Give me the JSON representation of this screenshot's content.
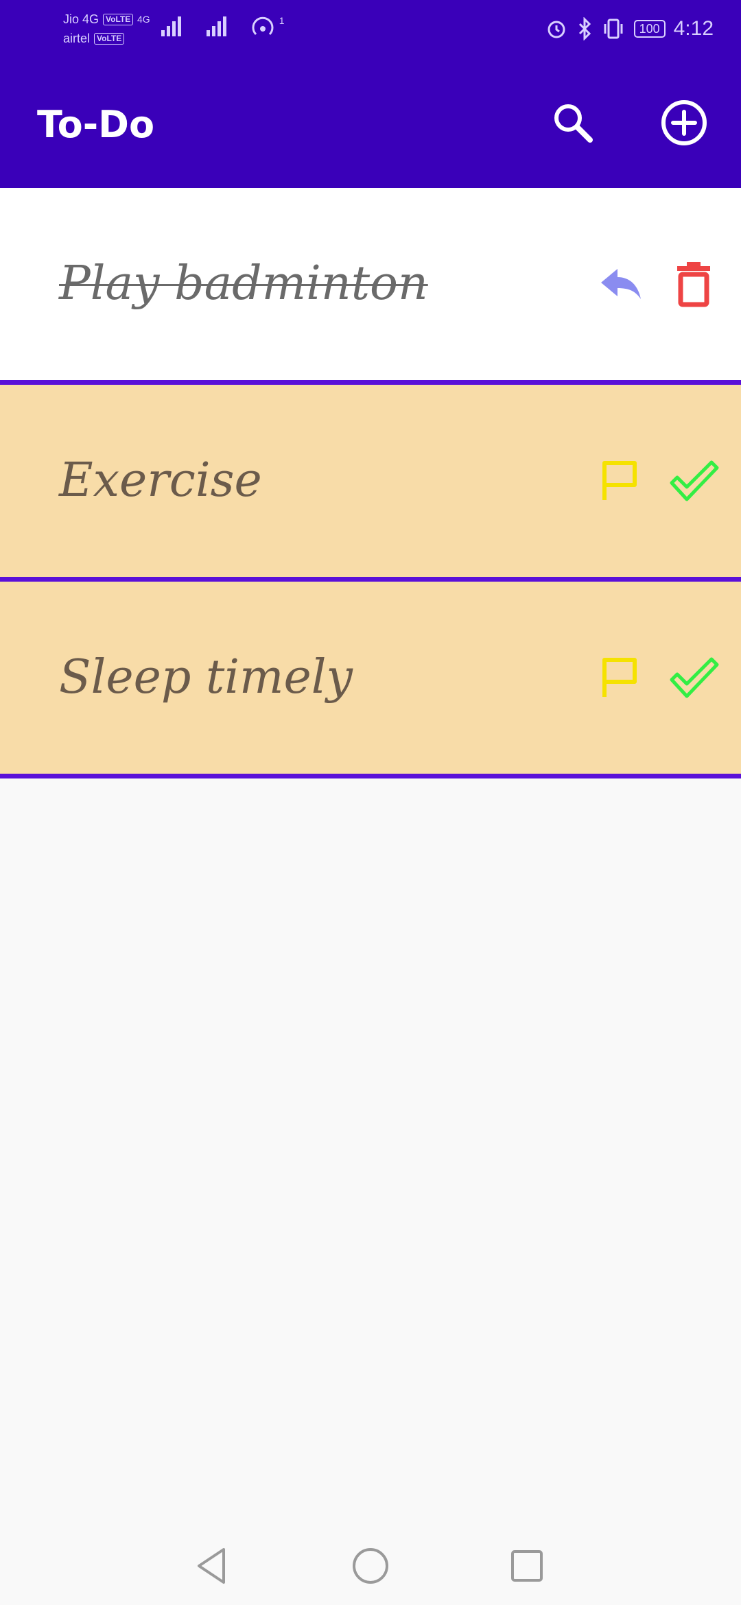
{
  "status_bar": {
    "carrier1": "Jio 4G",
    "carrier1_badge": "VoLTE",
    "carrier2": "airtel",
    "carrier2_badge": "VoLTE",
    "network": "4G",
    "hotspot_count": "1",
    "battery": "100",
    "time": "4:12"
  },
  "app_bar": {
    "title": "To-Do",
    "search_icon": "search-icon",
    "add_icon": "add-circle-icon"
  },
  "colors": {
    "primary": "#3a00b9",
    "divider": "#5a10d8",
    "pending_bg": "#f8dca8",
    "done_bg": "#ffffff",
    "flag": "#f5e200",
    "check": "#33ee44",
    "undo": "#8a8cf0",
    "delete": "#ee4444"
  },
  "tasks": [
    {
      "text": "Play badminton",
      "status": "done",
      "actions": [
        "undo-icon",
        "delete-icon"
      ]
    },
    {
      "text": "Exercise",
      "status": "pending",
      "actions": [
        "flag-icon",
        "check-icon"
      ]
    },
    {
      "text": "Sleep timely",
      "status": "pending",
      "actions": [
        "flag-icon",
        "check-icon"
      ]
    }
  ],
  "nav_bar": {
    "back_icon": "back-triangle-icon",
    "home_icon": "home-circle-icon",
    "recent_icon": "recents-square-icon"
  }
}
